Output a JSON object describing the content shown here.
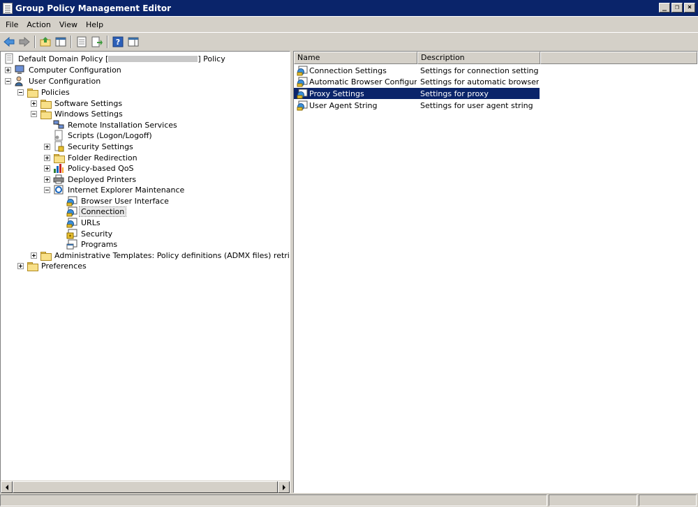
{
  "window": {
    "title": "Group Policy Management Editor"
  },
  "menu": [
    "File",
    "Action",
    "View",
    "Help"
  ],
  "toolbar": {
    "buttons": [
      "back-icon",
      "forward-icon",
      "up-folder-icon",
      "show-hide-tree-icon",
      "properties-icon",
      "export-list-icon",
      "help-icon",
      "show-hide-action-pane-icon"
    ]
  },
  "tree": {
    "root": {
      "label_prefix": "Default Domain Policy [",
      "label_suffix": "] Policy"
    },
    "computer_configuration": "Computer Configuration",
    "user_configuration": "User Configuration",
    "policies": "Policies",
    "software_settings": "Software Settings",
    "windows_settings": "Windows Settings",
    "remote_installation_services": "Remote Installation Services",
    "scripts": "Scripts (Logon/Logoff)",
    "security_settings": "Security Settings",
    "folder_redirection": "Folder Redirection",
    "policy_based_qos": "Policy-based QoS",
    "deployed_printers": "Deployed Printers",
    "internet_explorer_maintenance": "Internet Explorer Maintenance",
    "browser_user_interface": "Browser User Interface",
    "connection": "Connection",
    "urls": "URLs",
    "security": "Security",
    "programs": "Programs",
    "administrative_templates": "Administrative Templates: Policy definitions (ADMX files) retrieved from",
    "preferences": "Preferences"
  },
  "list": {
    "columns": [
      "Name",
      "Description"
    ],
    "rows": [
      {
        "name": "Connection Settings",
        "description": "Settings for connection settings"
      },
      {
        "name": "Automatic Browser Configurat...",
        "description": "Settings for automatic browser c..."
      },
      {
        "name": "Proxy Settings",
        "description": "Settings for proxy"
      },
      {
        "name": "User Agent String",
        "description": "Settings for user agent string"
      }
    ],
    "selected_row": "Proxy Settings"
  },
  "colors": {
    "title_bar": "#0a246a",
    "selection": "#0a246a",
    "face": "#d4d0c8"
  }
}
